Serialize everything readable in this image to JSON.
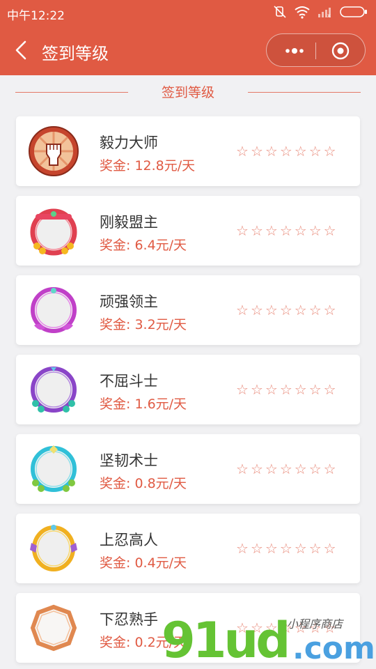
{
  "status_bar": {
    "time": "中午12:22"
  },
  "nav": {
    "title": "签到等级"
  },
  "section": {
    "title": "签到等级"
  },
  "levels": [
    {
      "name": "毅力大师",
      "reward": "奖金: 12.8元/天",
      "badge": "fist-badge-icon"
    },
    {
      "name": "刚毅盟主",
      "reward": "奖金: 6.4元/天",
      "badge": "red-frame-badge-icon"
    },
    {
      "name": "顽强领主",
      "reward": "奖金: 3.2元/天",
      "badge": "magenta-frame-badge-icon"
    },
    {
      "name": "不屈斗士",
      "reward": "奖金: 1.6元/天",
      "badge": "purple-frame-badge-icon"
    },
    {
      "name": "坚韧术士",
      "reward": "奖金: 0.8元/天",
      "badge": "cyan-frame-badge-icon"
    },
    {
      "name": "上忍高人",
      "reward": "奖金: 0.4元/天",
      "badge": "gold-frame-badge-icon"
    },
    {
      "name": "下忍熟手",
      "reward": "奖金: 0.2元/天",
      "badge": "bronze-frame-badge-icon"
    }
  ],
  "stars_per_level": 7,
  "watermark": {
    "logo": "91ud",
    "suffix": ".com",
    "tagline": "小程序商店"
  },
  "colors": {
    "accent": "#e05a43",
    "star": "#e88a7a",
    "background": "#f1f1f3"
  }
}
